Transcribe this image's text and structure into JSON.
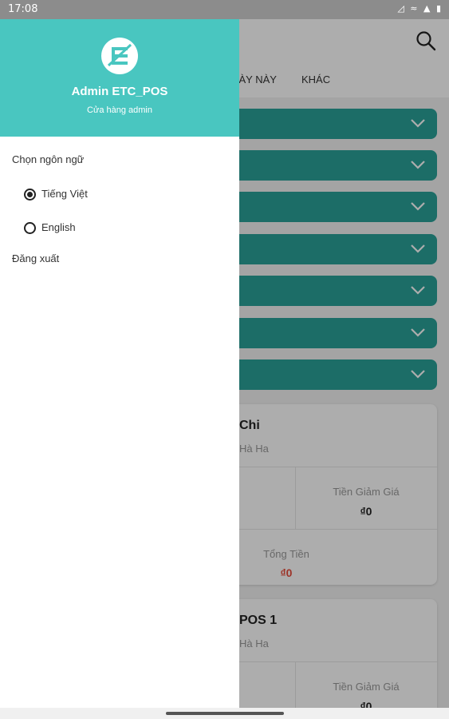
{
  "status_bar": {
    "time": "17:08",
    "icons": "◿ ≈ ▲ ▮"
  },
  "tabs": [
    {
      "label": "NGÀY NÀY"
    },
    {
      "label": "KHÁC"
    }
  ],
  "cards": [
    {
      "title": "Chi",
      "subtitle": "Hà Ha",
      "discount_label": "Tiền Giảm Giá",
      "discount_value": "₫0",
      "total_label": "Tổng Tiền",
      "total_value": "₫0"
    },
    {
      "title": "POS 1",
      "subtitle": "Hà Ha",
      "discount_label": "Tiền Giảm Giá",
      "discount_value": "₫0"
    }
  ],
  "drawer": {
    "admin_name": "Admin ETC_POS",
    "store_name": "Cửa hàng admin",
    "language_label": "Chọn ngôn ngữ",
    "languages": [
      {
        "label": "Tiếng Việt",
        "selected": true
      },
      {
        "label": "English",
        "selected": false
      }
    ],
    "logout_label": "Đăng xuất"
  },
  "colors": {
    "header": "#49c6c0",
    "bar": "#2aa198",
    "total_value": "#e74c3c"
  }
}
